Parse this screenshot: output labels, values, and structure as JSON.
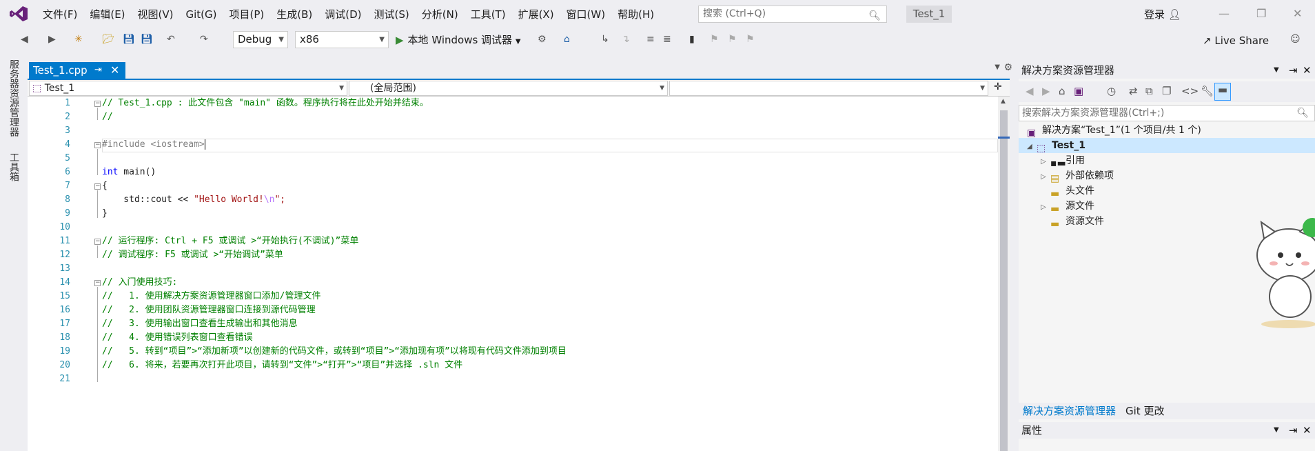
{
  "menu": [
    "文件(F)",
    "编辑(E)",
    "视图(V)",
    "Git(G)",
    "项目(P)",
    "生成(B)",
    "调试(D)",
    "测试(S)",
    "分析(N)",
    "工具(T)",
    "扩展(X)",
    "窗口(W)",
    "帮助(H)"
  ],
  "search": {
    "placeholder": "搜索 (Ctrl+Q)"
  },
  "project_badge": "Test_1",
  "login": "登录",
  "toolbar": {
    "config": "Debug",
    "platform": "x86",
    "run_label": "本地 Windows 调试器",
    "live_share": "Live Share"
  },
  "left_tabs": [
    "服务器资源管理器",
    "工具箱"
  ],
  "doc_tab": {
    "label": "Test_1.cpp"
  },
  "nav": {
    "project": "Test_1",
    "scope": "(全局范围)",
    "member": ""
  },
  "line_numbers": [
    "1",
    "2",
    "3",
    "4",
    "5",
    "6",
    "7",
    "8",
    "9",
    "10",
    "11",
    "12",
    "13",
    "14",
    "15",
    "16",
    "17",
    "18",
    "19",
    "20",
    "21"
  ],
  "code": {
    "l1": "// Test_1.cpp : 此文件包含 \"main\" 函数。程序执行将在此处开始并结束。",
    "l2": "//",
    "l4": "#include <iostream>",
    "l6_kw": "int",
    "l6_rest": " main()",
    "l7": "{",
    "l8_a": "    std::cout << ",
    "l8_str": "\"Hello World!",
    "l8_esc": "\\n",
    "l8_end": "\";",
    "l9": "}",
    "l11": "// 运行程序: Ctrl + F5 或调试 >“开始执行(不调试)”菜单",
    "l12": "// 调试程序: F5 或调试 >“开始调试”菜单",
    "l14": "// 入门使用技巧:",
    "l15": "//   1. 使用解决方案资源管理器窗口添加/管理文件",
    "l16": "//   2. 使用团队资源管理器窗口连接到源代码管理",
    "l17": "//   3. 使用输出窗口查看生成输出和其他消息",
    "l18": "//   4. 使用错误列表窗口查看错误",
    "l19": "//   5. 转到“项目”>“添加新项”以创建新的代码文件，或转到“项目”>“添加现有项”以将现有代码文件添加到项目",
    "l20": "//   6. 将来，若要再次打开此项目，请转到“文件”>“打开”>“项目”并选择 .sln 文件"
  },
  "solution_explorer": {
    "title": "解决方案资源管理器",
    "search_placeholder": "搜索解决方案资源管理器(Ctrl+;)",
    "solution": "解决方案“Test_1”(1 个项目/共 1 个)",
    "project": "Test_1",
    "nodes": [
      "引用",
      "外部依赖项",
      "头文件",
      "源文件",
      "资源文件"
    ],
    "tabs": [
      "解决方案资源管理器",
      "Git 更改"
    ]
  },
  "properties": {
    "title": "属性"
  }
}
